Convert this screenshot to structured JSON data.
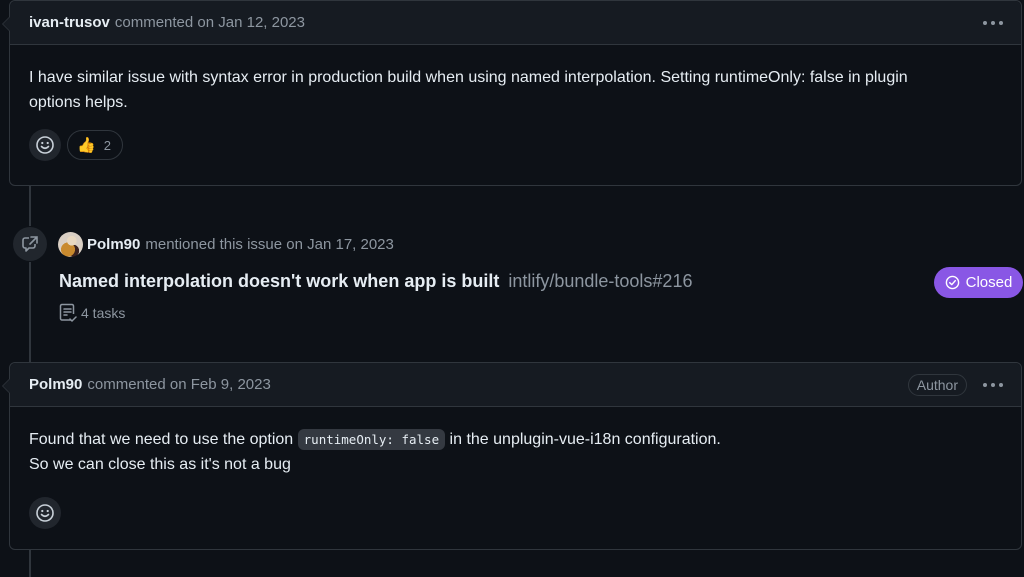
{
  "comments": [
    {
      "author": "ivan-trusov",
      "meta": "commented on Jan 12, 2023",
      "body_lines": [
        "I have similar issue with syntax error in production build when using named interpolation. Setting runtimeOnly: false in plugin",
        "options helps."
      ],
      "reactions": [
        {
          "emoji": "👍",
          "icon": "thumbs-up-icon",
          "count": "2"
        }
      ],
      "badge": null
    },
    {
      "author": "Polm90",
      "meta": "commented on Feb 9, 2023",
      "badge": "Author",
      "body": {
        "line1_before": "Found that we need to use the option ",
        "line1_code": "runtimeOnly: false",
        "line1_after": " in the unplugin-vue-i18n configuration.",
        "line2": "So we can close this as it's not a bug"
      }
    }
  ],
  "mention_event": {
    "icon": "cross-reference-icon",
    "user": "Polm90",
    "meta": "mentioned this issue on Jan 17, 2023",
    "issue_title": "Named interpolation doesn't work when app is built",
    "issue_ref": "intlify/bundle-tools#216",
    "tasks": "4 tasks",
    "status": "Closed",
    "status_color": "#8957e5"
  },
  "colors": {
    "background": "#0d1117",
    "header_bg": "#161b22",
    "border": "#30363d",
    "muted": "#8d96a0",
    "text": "#e6edf3"
  }
}
